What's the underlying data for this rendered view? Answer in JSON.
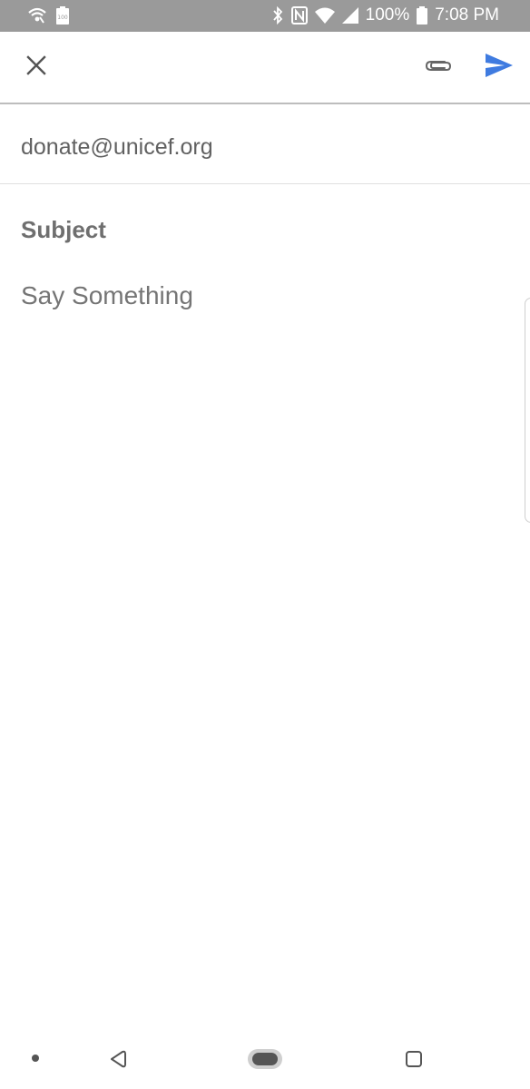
{
  "status_bar": {
    "battery_percent": "100%",
    "time": "7:08 PM",
    "icons": [
      "wifi-call-icon",
      "battery-saver-icon",
      "bluetooth-icon",
      "nfc-icon",
      "wifi-icon",
      "signal-icon",
      "battery-icon"
    ]
  },
  "toolbar": {
    "close_icon": "close-icon",
    "attach_icon": "paperclip-icon",
    "send_icon": "send-icon",
    "send_color": "#3f7be0"
  },
  "compose": {
    "to": "donate@unicef.org",
    "subject_placeholder": "Subject",
    "body_placeholder": "Say Something"
  },
  "nav_bar": {
    "icons": [
      "dot-icon",
      "back-icon",
      "home-icon",
      "recent-apps-icon"
    ]
  }
}
